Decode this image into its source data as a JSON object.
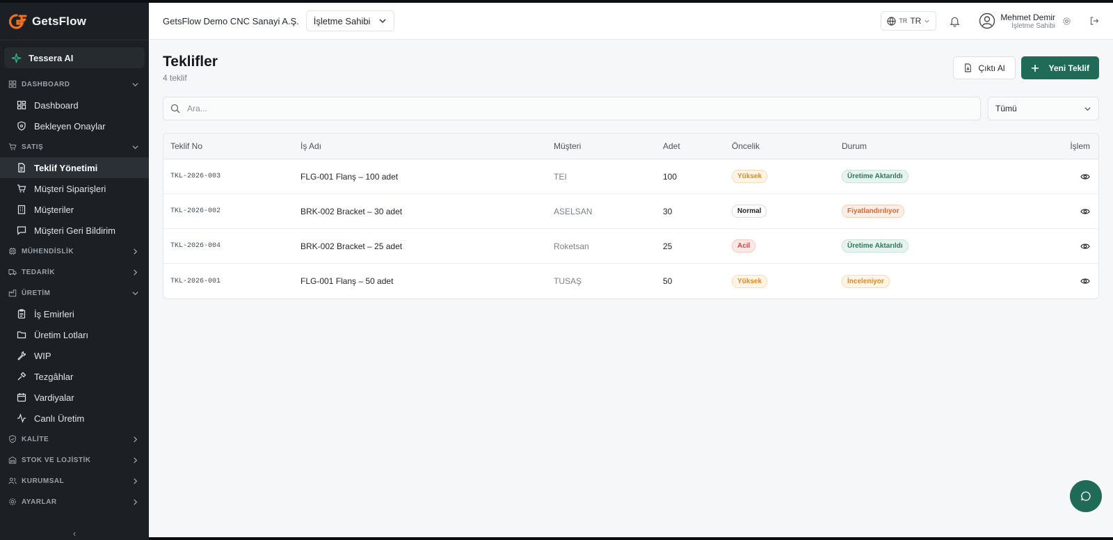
{
  "brand": {
    "name": "GetsFlow"
  },
  "sidebar": {
    "ai_item": "Tessera AI",
    "sections": [
      {
        "label": "DASHBOARD",
        "icon": "dashboard-icon",
        "expanded": true,
        "items": [
          {
            "label": "Dashboard",
            "icon": "grid-icon"
          },
          {
            "label": "Bekleyen Onaylar",
            "icon": "shield-icon"
          }
        ]
      },
      {
        "label": "SATIŞ",
        "icon": "cart-icon",
        "expanded": true,
        "items": [
          {
            "label": "Teklif Yönetimi",
            "icon": "file-icon",
            "active": true
          },
          {
            "label": "Müşteri Siparişleri",
            "icon": "cart-icon"
          },
          {
            "label": "Müşteriler",
            "icon": "building-icon"
          },
          {
            "label": "Müşteri Geri Bildirim",
            "icon": "message-icon"
          }
        ]
      },
      {
        "label": "MÜHENDİSLİK",
        "icon": "cpu-icon",
        "expanded": false,
        "items": []
      },
      {
        "label": "TEDARİK",
        "icon": "truck-icon",
        "expanded": false,
        "items": []
      },
      {
        "label": "ÜRETİM",
        "icon": "factory-icon",
        "expanded": true,
        "items": [
          {
            "label": "İş Emirleri",
            "icon": "clipboard-icon"
          },
          {
            "label": "Üretim Lotları",
            "icon": "folder-icon"
          },
          {
            "label": "WIP",
            "icon": "wrench-icon"
          },
          {
            "label": "Tezgâhlar",
            "icon": "tool-icon"
          },
          {
            "label": "Vardiyalar",
            "icon": "calendar-icon"
          },
          {
            "label": "Canlı Üretim",
            "icon": "activity-icon"
          }
        ]
      },
      {
        "label": "KALİTE",
        "icon": "shield-check-icon",
        "expanded": false,
        "items": []
      },
      {
        "label": "STOK VE LOJİSTİK",
        "icon": "warehouse-icon",
        "expanded": false,
        "items": []
      },
      {
        "label": "KURUMSAL",
        "icon": "users-icon",
        "expanded": false,
        "items": []
      },
      {
        "label": "AYARLAR",
        "icon": "gear-icon",
        "expanded": false,
        "items": []
      }
    ],
    "collapse_glyph": "‹"
  },
  "topbar": {
    "company": "GetsFlow Demo CNC Sanayi A.Ş.",
    "role_select": "İşletme Sahibi",
    "language_flag": "TR",
    "language": "TR",
    "user_name": "Mehmet Demir",
    "user_role": "İşletme Sahibi"
  },
  "page": {
    "title": "Teklifler",
    "subtitle": "4 teklif",
    "export_label": "Çıktı Al",
    "new_label": "Yeni Teklif",
    "search_placeholder": "Ara...",
    "filter_value": "Tümü"
  },
  "table": {
    "columns": [
      "Teklif No",
      "İş Adı",
      "Müşteri",
      "Adet",
      "Öncelik",
      "Durum",
      "İşlem"
    ],
    "rows": [
      {
        "no": "TKL-2026-003",
        "job": "FLG-001 Flanş – 100 adet",
        "customer": "TEI",
        "qty": "100",
        "priority": "Yüksek",
        "priority_kind": "high",
        "status": "Üretime Aktarıldı",
        "status_kind": "green"
      },
      {
        "no": "TKL-2026-002",
        "job": "BRK-002 Bracket – 30 adet",
        "customer": "ASELSAN",
        "qty": "30",
        "priority": "Normal",
        "priority_kind": "normal",
        "status": "Fiyatlandırılıyor",
        "status_kind": "pricing"
      },
      {
        "no": "TKL-2026-004",
        "job": "BRK-002 Bracket – 25 adet",
        "customer": "Roketsan",
        "qty": "25",
        "priority": "Acil",
        "priority_kind": "urgent",
        "status": "Üretime Aktarıldı",
        "status_kind": "green"
      },
      {
        "no": "TKL-2026-001",
        "job": "FLG-001 Flanş – 50 adet",
        "customer": "TUSAŞ",
        "qty": "50",
        "priority": "Yüksek",
        "priority_kind": "high",
        "status": "İnceleniyor",
        "status_kind": "review"
      }
    ]
  },
  "colors": {
    "accent": "#1f6b58",
    "sidebar_bg": "#1c2024",
    "brand_orange": "#f0701e"
  }
}
